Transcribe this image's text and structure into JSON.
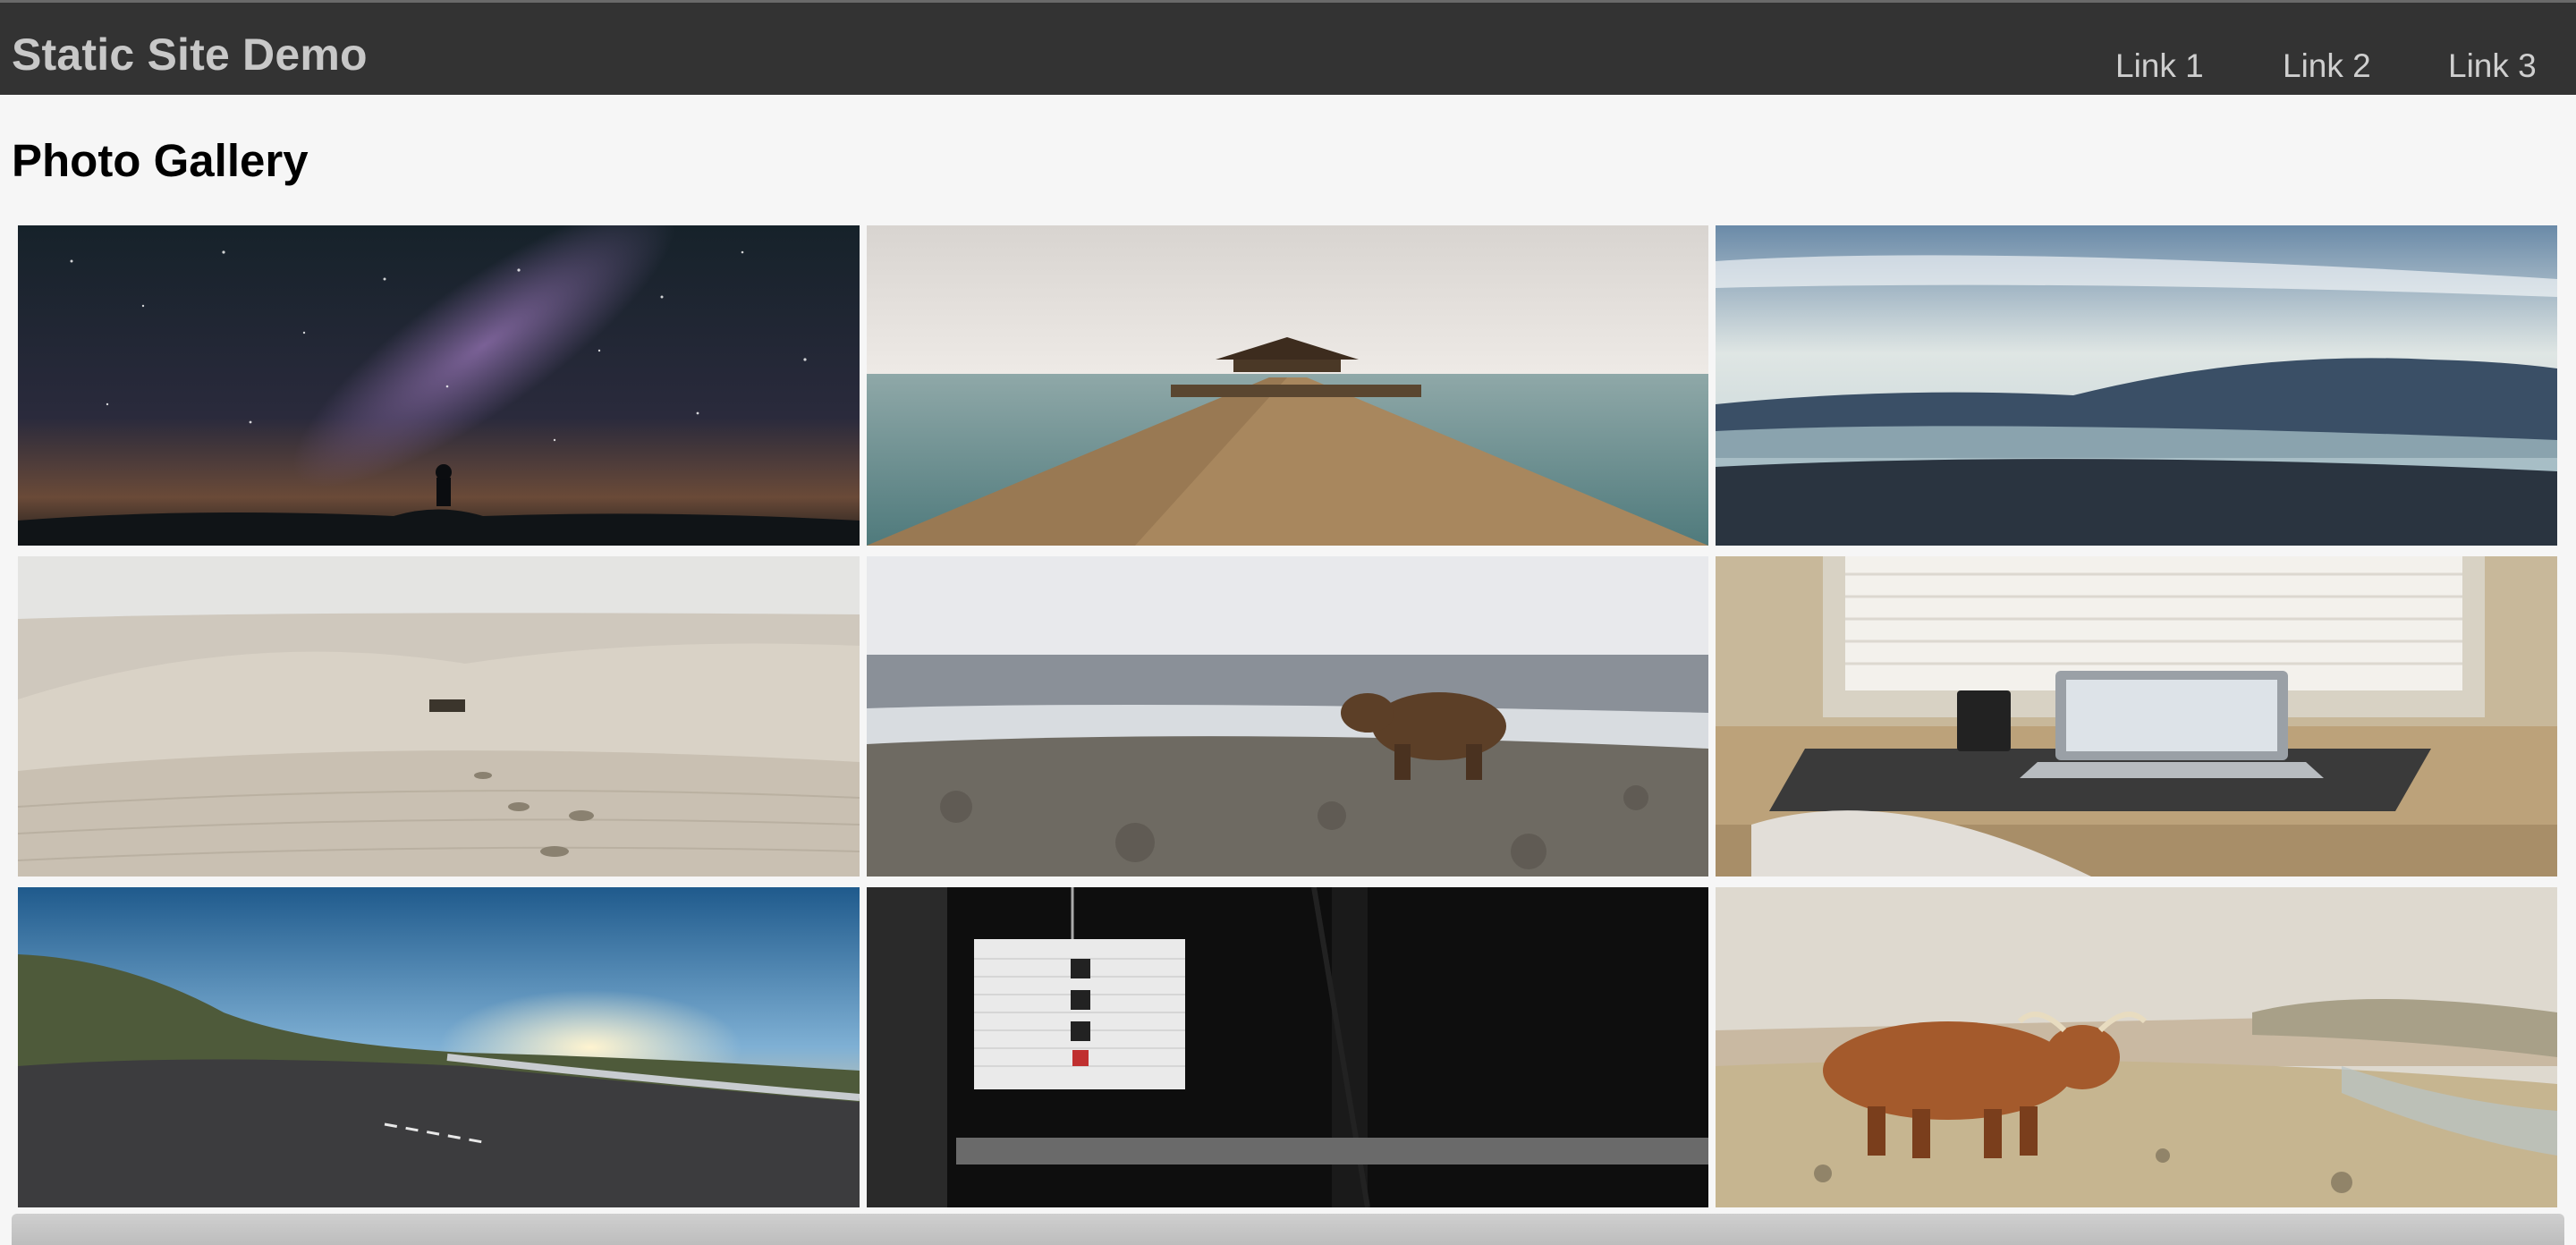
{
  "header": {
    "brand": "Static Site Demo",
    "links": [
      "Link 1",
      "Link 2",
      "Link 3"
    ]
  },
  "main": {
    "title": "Photo Gallery",
    "photos": [
      {
        "subject": "milky-way-night-sky"
      },
      {
        "subject": "wooden-pier-gazebo-sea"
      },
      {
        "subject": "misty-mountain-valley"
      },
      {
        "subject": "desert-dunes-footprints"
      },
      {
        "subject": "bear-on-rocks"
      },
      {
        "subject": "laptop-on-desk-window"
      },
      {
        "subject": "coastal-road-sunset"
      },
      {
        "subject": "paper-lantern-calligraphy"
      },
      {
        "subject": "highland-cow-beach"
      }
    ]
  },
  "colors": {
    "navbar_bg": "#333333",
    "brand_text": "#c8c8c8",
    "page_bg": "#f6f6f6"
  }
}
